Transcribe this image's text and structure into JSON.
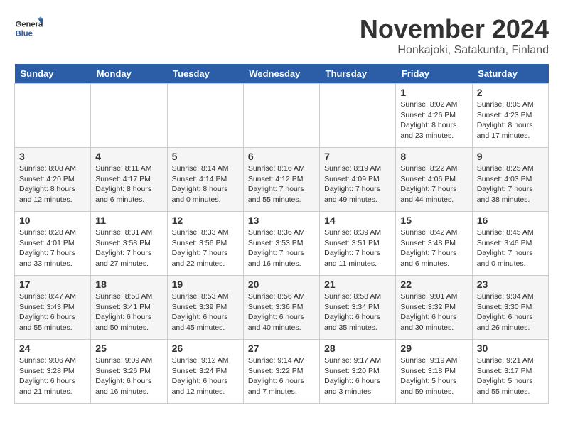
{
  "logo": {
    "general": "General",
    "blue": "Blue"
  },
  "header": {
    "month": "November 2024",
    "location": "Honkajoki, Satakunta, Finland"
  },
  "weekdays": [
    "Sunday",
    "Monday",
    "Tuesday",
    "Wednesday",
    "Thursday",
    "Friday",
    "Saturday"
  ],
  "weeks": [
    [
      {
        "day": "",
        "info": ""
      },
      {
        "day": "",
        "info": ""
      },
      {
        "day": "",
        "info": ""
      },
      {
        "day": "",
        "info": ""
      },
      {
        "day": "",
        "info": ""
      },
      {
        "day": "1",
        "info": "Sunrise: 8:02 AM\nSunset: 4:26 PM\nDaylight: 8 hours and 23 minutes."
      },
      {
        "day": "2",
        "info": "Sunrise: 8:05 AM\nSunset: 4:23 PM\nDaylight: 8 hours and 17 minutes."
      }
    ],
    [
      {
        "day": "3",
        "info": "Sunrise: 8:08 AM\nSunset: 4:20 PM\nDaylight: 8 hours and 12 minutes."
      },
      {
        "day": "4",
        "info": "Sunrise: 8:11 AM\nSunset: 4:17 PM\nDaylight: 8 hours and 6 minutes."
      },
      {
        "day": "5",
        "info": "Sunrise: 8:14 AM\nSunset: 4:14 PM\nDaylight: 8 hours and 0 minutes."
      },
      {
        "day": "6",
        "info": "Sunrise: 8:16 AM\nSunset: 4:12 PM\nDaylight: 7 hours and 55 minutes."
      },
      {
        "day": "7",
        "info": "Sunrise: 8:19 AM\nSunset: 4:09 PM\nDaylight: 7 hours and 49 minutes."
      },
      {
        "day": "8",
        "info": "Sunrise: 8:22 AM\nSunset: 4:06 PM\nDaylight: 7 hours and 44 minutes."
      },
      {
        "day": "9",
        "info": "Sunrise: 8:25 AM\nSunset: 4:03 PM\nDaylight: 7 hours and 38 minutes."
      }
    ],
    [
      {
        "day": "10",
        "info": "Sunrise: 8:28 AM\nSunset: 4:01 PM\nDaylight: 7 hours and 33 minutes."
      },
      {
        "day": "11",
        "info": "Sunrise: 8:31 AM\nSunset: 3:58 PM\nDaylight: 7 hours and 27 minutes."
      },
      {
        "day": "12",
        "info": "Sunrise: 8:33 AM\nSunset: 3:56 PM\nDaylight: 7 hours and 22 minutes."
      },
      {
        "day": "13",
        "info": "Sunrise: 8:36 AM\nSunset: 3:53 PM\nDaylight: 7 hours and 16 minutes."
      },
      {
        "day": "14",
        "info": "Sunrise: 8:39 AM\nSunset: 3:51 PM\nDaylight: 7 hours and 11 minutes."
      },
      {
        "day": "15",
        "info": "Sunrise: 8:42 AM\nSunset: 3:48 PM\nDaylight: 7 hours and 6 minutes."
      },
      {
        "day": "16",
        "info": "Sunrise: 8:45 AM\nSunset: 3:46 PM\nDaylight: 7 hours and 0 minutes."
      }
    ],
    [
      {
        "day": "17",
        "info": "Sunrise: 8:47 AM\nSunset: 3:43 PM\nDaylight: 6 hours and 55 minutes."
      },
      {
        "day": "18",
        "info": "Sunrise: 8:50 AM\nSunset: 3:41 PM\nDaylight: 6 hours and 50 minutes."
      },
      {
        "day": "19",
        "info": "Sunrise: 8:53 AM\nSunset: 3:39 PM\nDaylight: 6 hours and 45 minutes."
      },
      {
        "day": "20",
        "info": "Sunrise: 8:56 AM\nSunset: 3:36 PM\nDaylight: 6 hours and 40 minutes."
      },
      {
        "day": "21",
        "info": "Sunrise: 8:58 AM\nSunset: 3:34 PM\nDaylight: 6 hours and 35 minutes."
      },
      {
        "day": "22",
        "info": "Sunrise: 9:01 AM\nSunset: 3:32 PM\nDaylight: 6 hours and 30 minutes."
      },
      {
        "day": "23",
        "info": "Sunrise: 9:04 AM\nSunset: 3:30 PM\nDaylight: 6 hours and 26 minutes."
      }
    ],
    [
      {
        "day": "24",
        "info": "Sunrise: 9:06 AM\nSunset: 3:28 PM\nDaylight: 6 hours and 21 minutes."
      },
      {
        "day": "25",
        "info": "Sunrise: 9:09 AM\nSunset: 3:26 PM\nDaylight: 6 hours and 16 minutes."
      },
      {
        "day": "26",
        "info": "Sunrise: 9:12 AM\nSunset: 3:24 PM\nDaylight: 6 hours and 12 minutes."
      },
      {
        "day": "27",
        "info": "Sunrise: 9:14 AM\nSunset: 3:22 PM\nDaylight: 6 hours and 7 minutes."
      },
      {
        "day": "28",
        "info": "Sunrise: 9:17 AM\nSunset: 3:20 PM\nDaylight: 6 hours and 3 minutes."
      },
      {
        "day": "29",
        "info": "Sunrise: 9:19 AM\nSunset: 3:18 PM\nDaylight: 5 hours and 59 minutes."
      },
      {
        "day": "30",
        "info": "Sunrise: 9:21 AM\nSunset: 3:17 PM\nDaylight: 5 hours and 55 minutes."
      }
    ]
  ]
}
